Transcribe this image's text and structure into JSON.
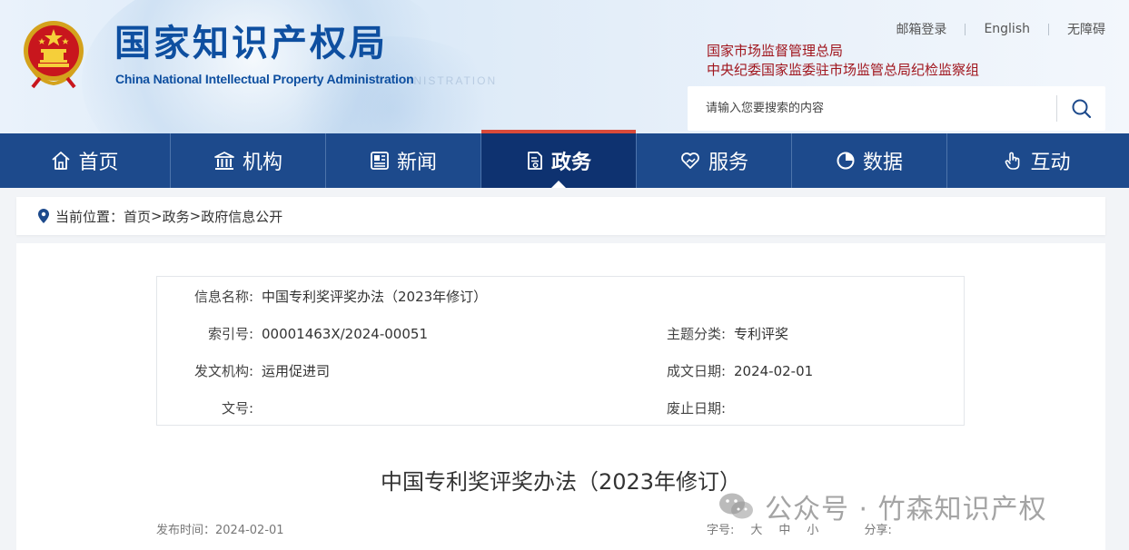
{
  "header": {
    "logo_cn": "国家知识产权局",
    "logo_en": "China National Intellectual Property Administration",
    "watermark": "INISTRATION",
    "top_links": [
      "邮箱登录",
      "English",
      "无障碍"
    ],
    "departments": [
      "国家市场监督管理总局",
      "中央纪委国家监委驻市场监管总局纪检监察组"
    ],
    "search": {
      "placeholder": "请输入您要搜索的内容",
      "icon": "search-icon"
    }
  },
  "nav": {
    "items": [
      {
        "label": "首页",
        "icon": "home-icon"
      },
      {
        "label": "机构",
        "icon": "building-icon"
      },
      {
        "label": "新闻",
        "icon": "news-icon"
      },
      {
        "label": "政务",
        "icon": "document-icon",
        "active": true
      },
      {
        "label": "服务",
        "icon": "heart-hand-icon"
      },
      {
        "label": "数据",
        "icon": "pie-chart-icon"
      },
      {
        "label": "互动",
        "icon": "hand-pointer-icon"
      }
    ],
    "background": "#1d4a8c",
    "active_background": "#0e3270",
    "active_accent": "#d94a3a"
  },
  "breadcrumb": {
    "prefix": "当前位置：",
    "items": [
      "首页",
      "政务",
      "政府信息公开"
    ],
    "sep": ">"
  },
  "info": {
    "name_label": "信息名称:",
    "name_value": "中国专利奖评奖办法（2023年修订）",
    "index_label": "索引号:",
    "index_value": "00001463X/2024-00051",
    "topic_label": "主题分类:",
    "topic_value": "专利评奖",
    "issuer_label": "发文机构:",
    "issuer_value": "运用促进司",
    "date_label": "成文日期:",
    "date_value": "2024-02-01",
    "docno_label": "文号:",
    "docno_value": "",
    "abolish_label": "废止日期:",
    "abolish_value": ""
  },
  "article": {
    "title": "中国专利奖评奖办法（2023年修订）",
    "publish_label": "发布时间：",
    "publish_date": "2024-02-01",
    "font_label": "字号:",
    "font_sizes": [
      "大",
      "中",
      "小"
    ],
    "share_label": "分享:"
  },
  "watermark": {
    "text": "公众号 · 竹森知识产权",
    "icon": "wechat-icon"
  }
}
